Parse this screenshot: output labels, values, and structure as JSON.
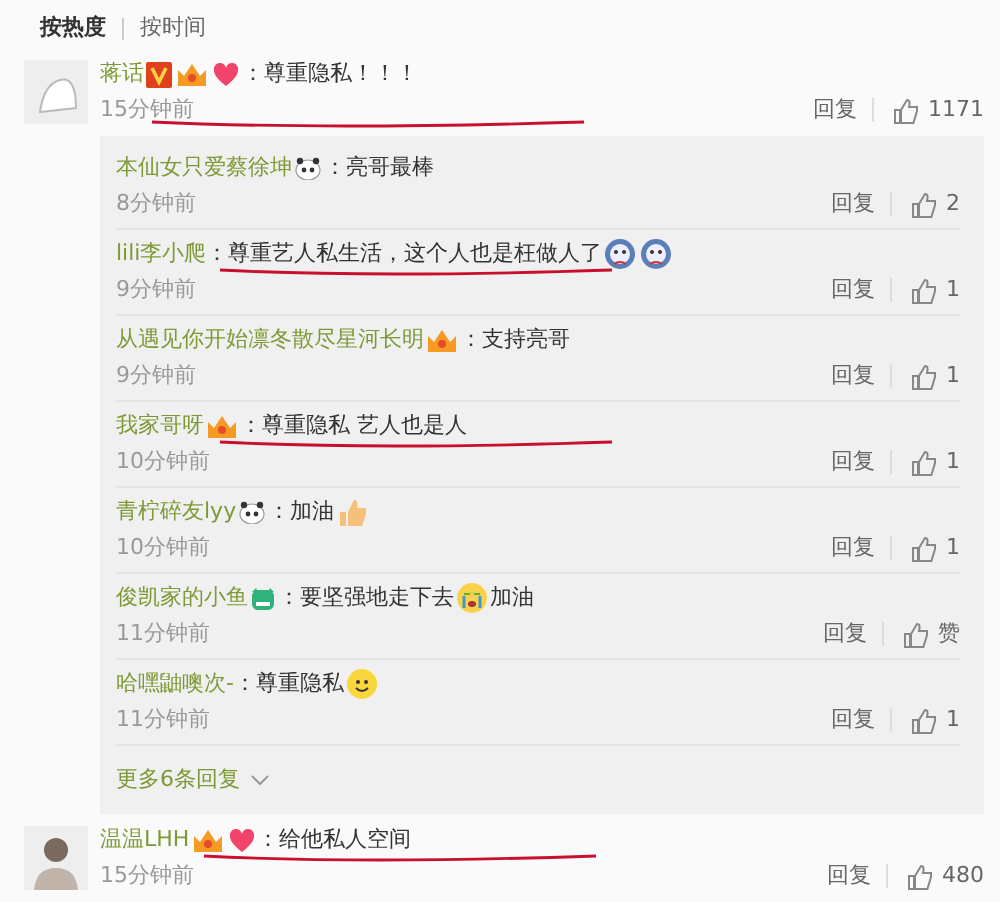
{
  "sort_tabs": [
    {
      "label": "按热度",
      "selected": true
    },
    {
      "label": "按时间",
      "selected": false
    }
  ],
  "comments": [
    {
      "name": "蒋话",
      "content": [
        {
          "kind": "text",
          "text": "：尊重隐私！！！"
        }
      ],
      "time": "15分钟前",
      "reply": "回复",
      "likes": "1171",
      "underlined": true,
      "replies": [
        {
          "name": "本仙女只爱蔡徐坤",
          "content": [
            {
              "kind": "text",
              "text": "：亮哥最棒"
            }
          ],
          "time": "8分钟前",
          "reply": "回复",
          "likes": "2",
          "underlined": false
        },
        {
          "name": "lili李小爬",
          "content": [
            {
              "kind": "text",
              "text": "：尊重艺人私生活，这个人也是枉做人了"
            },
            {
              "kind": "emoji"
            },
            {
              "kind": "emoji"
            }
          ],
          "time": "9分钟前",
          "reply": "回复",
          "likes": "1",
          "underlined": true
        },
        {
          "name": "从遇见你开始凛冬散尽星河长明",
          "content": [
            {
              "kind": "text",
              "text": "：支持亮哥"
            }
          ],
          "time": "9分钟前",
          "reply": "回复",
          "likes": "1",
          "underlined": false
        },
        {
          "name": "我家哥呀",
          "content": [
            {
              "kind": "text",
              "text": "：尊重隐私  艺人也是人"
            }
          ],
          "time": "10分钟前",
          "reply": "回复",
          "likes": "1",
          "underlined": true
        },
        {
          "name": "青柠碎友lyy",
          "content": [
            {
              "kind": "text",
              "text": "：加油"
            },
            {
              "kind": "emoji"
            }
          ],
          "time": "10分钟前",
          "reply": "回复",
          "likes": "1",
          "underlined": false
        },
        {
          "name": "俊凯家的小鱼",
          "content": [
            {
              "kind": "text",
              "text": "：要坚强地走下去"
            },
            {
              "kind": "emoji"
            },
            {
              "kind": "text",
              "text": "加油"
            }
          ],
          "time": "11分钟前",
          "reply": "回复",
          "likes": "赞",
          "underlined": false
        },
        {
          "name": "哈嘿鼬噢次-",
          "content": [
            {
              "kind": "text",
              "text": "：尊重隐私"
            },
            {
              "kind": "emoji"
            }
          ],
          "time": "11分钟前",
          "reply": "回复",
          "likes": "1",
          "underlined": false
        }
      ],
      "more": "更多6条回复"
    },
    {
      "name": "温温LHH",
      "content": [
        {
          "kind": "text",
          "text": "：给他私人空间"
        }
      ],
      "time": "15分钟前",
      "reply": "回复",
      "likes": "480",
      "underlined": true
    }
  ]
}
